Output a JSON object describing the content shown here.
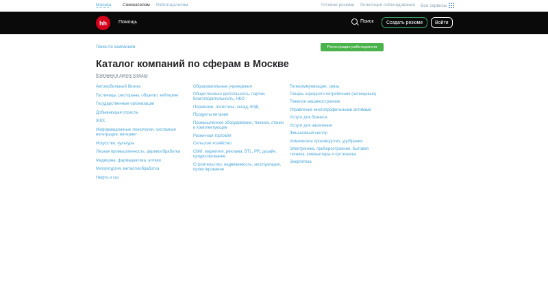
{
  "topbar": {
    "city": "Москва",
    "seekers": "Соискателям",
    "employers": "Работодателям",
    "ready_resumes": "Готовое резюме",
    "interview_rehearsal": "Репетиция собеседования",
    "all_services": "Все сервисы"
  },
  "navbar": {
    "logo": "hh",
    "help": "Помощь",
    "search": "Поиск",
    "create_resume": "Создать резюме",
    "login": "Войти"
  },
  "page": {
    "breadcrumb": "Поиск по компаниям",
    "register_employer": "Регистрация работодателя",
    "title": "Каталог компаний по сферам в Москве",
    "other_cities": "Компании в других городах"
  },
  "columns": [
    {
      "items": [
        "Автомобильный бизнес",
        "Гостиницы, рестораны, общепит, кейтеринг",
        "Государственные организации",
        "Добывающая отрасль",
        "ЖКХ",
        "Информационные технологии, системная интеграция, интернет",
        "Искусство, культура",
        "Лесная промышленность, деревообработка",
        "Медицина, фармацевтика, аптеки",
        "Металлургия, металлообработка",
        "Нефть и газ"
      ]
    },
    {
      "items": [
        "Образовательные учреждения",
        "Общественная деятельность, партии, благотворительность, НКО",
        "Перевозки, логистика, склад, ВЭД",
        "Продукты питания",
        "Промышленное оборудование, техника, станки и комплектующие",
        "Розничная торговля",
        "Сельское хозяйство",
        "СМИ, маркетинг, реклама, BTL, PR, дизайн, продюсирование",
        "Строительство, недвижимость, эксплуатация, проектирование"
      ]
    },
    {
      "items": [
        "Телекоммуникации, связь",
        "Товары народного потребления (непищевые)",
        "Тяжелое машиностроение",
        "Управление многопрофильными активами",
        "Услуги для бизнеса",
        "Услуги для населения",
        "Финансовый сектор",
        "Химическое производство, удобрения",
        "Электроника, приборостроение, бытовая техника, компьютеры и оргтехника",
        "Энергетика"
      ]
    }
  ]
}
